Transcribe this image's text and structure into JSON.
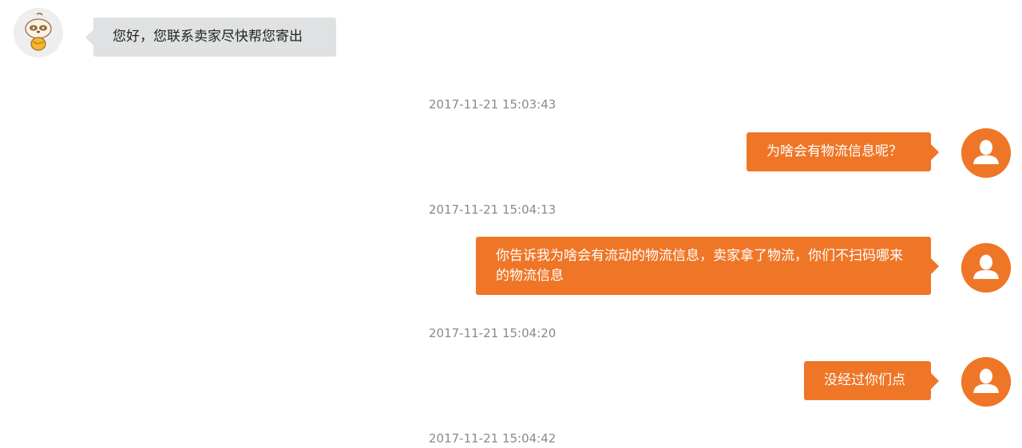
{
  "messages": [
    {
      "sender": "agent",
      "text": "您好，您联系卖家尽快帮您寄出"
    },
    {
      "timestamp": "2017-11-21 15:03:43",
      "sender": "user",
      "text": "为啥会有物流信息呢？"
    },
    {
      "timestamp": "2017-11-21 15:04:13",
      "sender": "user",
      "text": "你告诉我为啥会有流动的物流信息，卖家拿了物流，你们不扫码哪来的物流信息"
    },
    {
      "timestamp": "2017-11-21 15:04:20",
      "sender": "user",
      "text": "没经过你们点"
    },
    {
      "timestamp": "2017-11-21 15:04:42"
    }
  ],
  "icons": {
    "agent_avatar": "cartoon-animal-avatar-icon",
    "user_avatar": "default-user-avatar-icon"
  },
  "colors": {
    "user_bubble": "#ef7627",
    "agent_bubble": "#dfe1e2",
    "timestamp_text": "#8a8a8a"
  }
}
